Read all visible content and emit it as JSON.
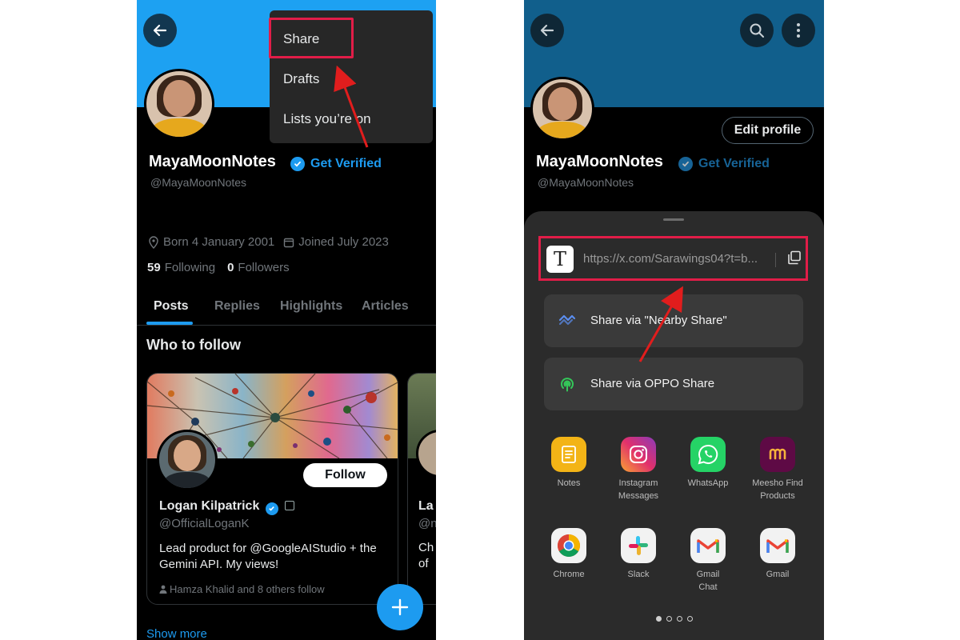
{
  "left": {
    "menu": {
      "items": [
        {
          "label": "Share",
          "highlighted": true
        },
        {
          "label": "Drafts"
        },
        {
          "label": "Lists you’re on"
        }
      ]
    },
    "profile": {
      "name": "MayaMoonNotes",
      "get_verified": "Get Verified",
      "handle": "@MayaMoonNotes",
      "born": "Born 4 January 2001",
      "joined": "Joined July 2023",
      "following_count": "59",
      "following_label": "Following",
      "followers_count": "0",
      "followers_label": "Followers"
    },
    "tabs": [
      "Posts",
      "Replies",
      "Highlights",
      "Articles"
    ],
    "who_to_follow": "Who to follow",
    "suggestion": {
      "name": "Logan Kilpatrick",
      "handle": "@OfficialLoganK",
      "bio": "Lead product for @GoogleAIStudio + the Gemini API. My views!",
      "follow_label": "Follow",
      "followed_by": "Hamza Khalid and 8 others follow"
    },
    "suggestion2_partial": {
      "name": "La",
      "handle": "@n",
      "bio1": "Ch",
      "bio2": "of"
    },
    "show_more": "Show more"
  },
  "right": {
    "profile": {
      "name": "MayaMoonNotes",
      "get_verified": "Get Verified",
      "handle": "@MayaMoonNotes",
      "edit_profile": "Edit profile"
    },
    "share_sheet": {
      "url": "https://x.com/Sarawings04?t=b...",
      "options": [
        {
          "label": "Share via \"Nearby Share\"",
          "icon": "nearby-share-icon"
        },
        {
          "label": "Share via OPPO Share",
          "icon": "oppo-share-icon"
        }
      ],
      "apps": [
        {
          "label": "Notes",
          "icon": "notes-icon"
        },
        {
          "label": "Instagram Messages",
          "icon": "instagram-icon"
        },
        {
          "label": "WhatsApp",
          "icon": "whatsapp-icon"
        },
        {
          "label": "Meesho Find Products",
          "icon": "meesho-icon"
        },
        {
          "label": "Chrome",
          "icon": "chrome-icon"
        },
        {
          "label": "Slack",
          "icon": "slack-icon"
        },
        {
          "label": "Gmail Chat",
          "icon": "gmail-icon"
        },
        {
          "label": "Gmail",
          "icon": "gmail-icon"
        }
      ],
      "page_dots": 4,
      "active_dot": 0
    }
  },
  "colors": {
    "accent": "#1d9bf0",
    "highlight_box": "#e11d48",
    "annotation_arrow": "#e11d1d"
  }
}
